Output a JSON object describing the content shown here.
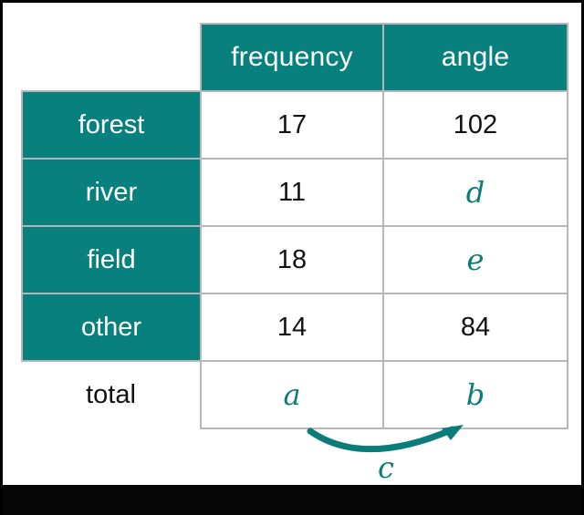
{
  "table": {
    "corner_label": "",
    "columns": [
      "frequency",
      "angle"
    ],
    "rows": [
      {
        "label": "forest",
        "frequency": "17",
        "angle": "102",
        "freq_is_var": false,
        "angle_is_var": false
      },
      {
        "label": "river",
        "frequency": "11",
        "angle": "d",
        "freq_is_var": false,
        "angle_is_var": true
      },
      {
        "label": "field",
        "frequency": "18",
        "angle": "e",
        "freq_is_var": false,
        "angle_is_var": true
      },
      {
        "label": "other",
        "frequency": "14",
        "angle": "84",
        "freq_is_var": false,
        "angle_is_var": false
      },
      {
        "label": "total",
        "frequency": "a",
        "angle": "b",
        "freq_is_var": true,
        "angle_is_var": true
      }
    ]
  },
  "annotation": {
    "arrow_label": "c",
    "arrow_direction": "left-to-right"
  },
  "colors": {
    "teal": "#08807d",
    "variable_teal": "#0a7d7a",
    "grid_line": "#b7b7b7",
    "text": "#111111",
    "header_text": "#ffffff",
    "frame": "#000000"
  }
}
